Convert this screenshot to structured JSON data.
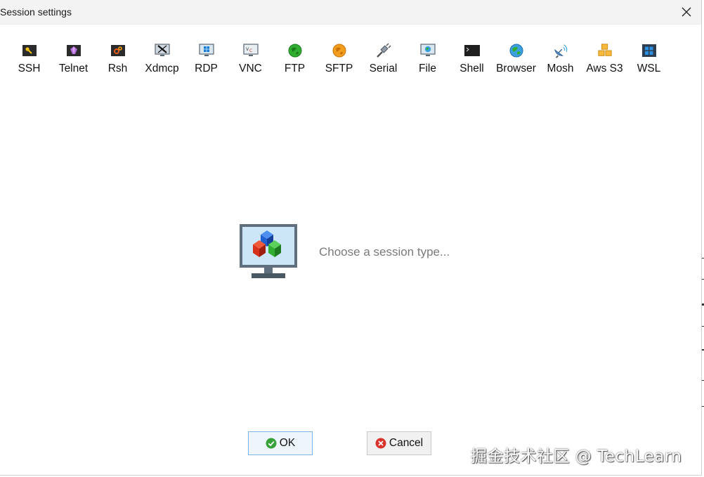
{
  "window": {
    "title": "Session settings"
  },
  "toolbar": {
    "items": [
      {
        "label": "SSH",
        "icon": "key-icon"
      },
      {
        "label": "Telnet",
        "icon": "gem-icon"
      },
      {
        "label": "Rsh",
        "icon": "gears-icon"
      },
      {
        "label": "Xdmcp",
        "icon": "x-display-icon"
      },
      {
        "label": "RDP",
        "icon": "windows-monitor-icon"
      },
      {
        "label": "VNC",
        "icon": "vnc-monitor-icon"
      },
      {
        "label": "FTP",
        "icon": "green-globe-icon"
      },
      {
        "label": "SFTP",
        "icon": "orange-globe-icon"
      },
      {
        "label": "Serial",
        "icon": "serial-plug-icon"
      },
      {
        "label": "File",
        "icon": "file-monitor-icon"
      },
      {
        "label": "Shell",
        "icon": "terminal-icon"
      },
      {
        "label": "Browser",
        "icon": "earth-icon"
      },
      {
        "label": "Mosh",
        "icon": "satellite-dish-icon"
      },
      {
        "label": "Aws S3",
        "icon": "cubes-icon"
      },
      {
        "label": "WSL",
        "icon": "windows-logo-icon"
      }
    ]
  },
  "main": {
    "hint": "Choose a session type..."
  },
  "buttons": {
    "ok_label": "OK",
    "cancel_label": "Cancel"
  },
  "watermark": "掘金技术社区 @ TechLearn",
  "colors": {
    "titlebar": "#f3f3f3",
    "hint_text": "#7a7a7a",
    "ok_border": "#7eb4ea"
  }
}
